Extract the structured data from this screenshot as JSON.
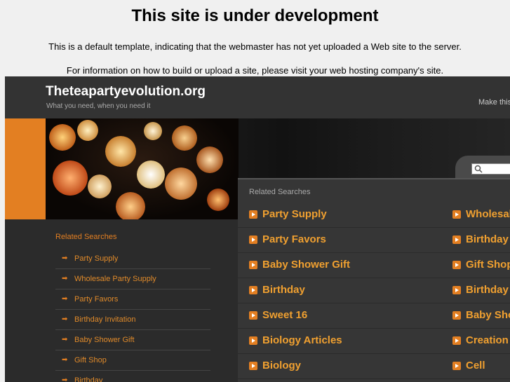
{
  "notice": {
    "title": "This site is under development",
    "line1": "This is a default template, indicating that the webmaster has not yet uploaded a Web site to the server.",
    "line2": "For information on how to build or upload a site, please visit your web hosting company's site."
  },
  "header": {
    "site_title": "Theteapartyevolution.org",
    "tagline": "What you need, when you need it",
    "make_home": "Make this"
  },
  "sidebar": {
    "heading": "Related Searches",
    "items": [
      "Party Supply",
      "Wholesale Party Supply",
      "Party Favors",
      "Birthday Invitation",
      "Baby Shower Gift",
      "Gift Shop",
      "Birthday"
    ]
  },
  "main": {
    "heading": "Related Searches",
    "left": [
      "Party Supply",
      "Party Favors",
      "Baby Shower Gift",
      "Birthday",
      "Sweet 16",
      "Biology Articles",
      "Biology"
    ],
    "right": [
      "Wholesale",
      "Birthday",
      "Gift Shop",
      "Birthday",
      "Baby Sho",
      "Creation",
      "Cell"
    ]
  },
  "colors": {
    "accent": "#e37f22",
    "link": "#f0a030",
    "background": "#2b2b2b"
  },
  "icons": {
    "search": "magnifier-icon",
    "arrow": "arrow-right-icon",
    "link": "orange-arrow-box-icon"
  }
}
